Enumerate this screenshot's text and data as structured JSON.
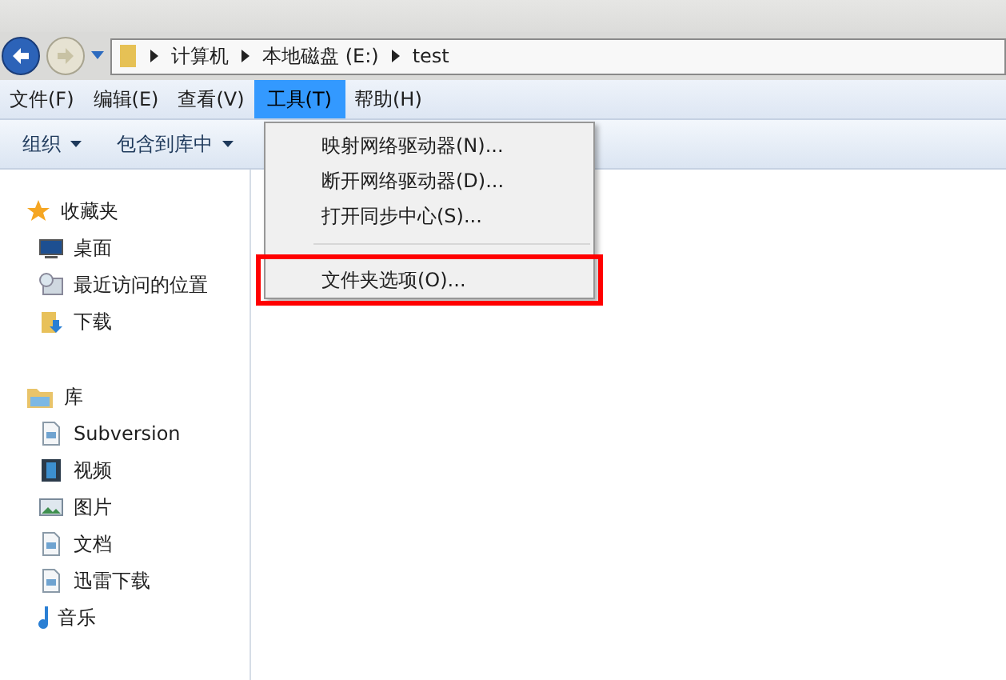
{
  "address_bar": {
    "segments": [
      "计算机",
      "本地磁盘 (E:)",
      "test"
    ]
  },
  "menu_bar": [
    {
      "label": "文件(F)",
      "selected": false
    },
    {
      "label": "编辑(E)",
      "selected": false
    },
    {
      "label": "查看(V)",
      "selected": false
    },
    {
      "label": "工具(T)",
      "selected": true
    },
    {
      "label": "帮助(H)",
      "selected": false
    }
  ],
  "toolbar": [
    "组织",
    "包含到库中"
  ],
  "dropdown_menu": [
    {
      "label": "映射网络驱动器(N)...",
      "kind": "item",
      "annotated": false
    },
    {
      "label": "断开网络驱动器(D)...",
      "kind": "item",
      "annotated": false
    },
    {
      "label": "打开同步中心(S)...",
      "kind": "item",
      "annotated": false
    },
    {
      "kind": "separator"
    },
    {
      "label": "文件夹选项(O)...",
      "kind": "item",
      "annotated": true
    }
  ],
  "sidebar": [
    {
      "label": "收藏夹",
      "kind": "star",
      "children": [
        {
          "label": "桌面",
          "kind": "desktop"
        },
        {
          "label": "最近访问的位置",
          "kind": "recent"
        },
        {
          "label": "下载",
          "kind": "download"
        }
      ]
    },
    {
      "label": "库",
      "kind": "library",
      "children": [
        {
          "label": "Subversion",
          "kind": "doc"
        },
        {
          "label": "视频",
          "kind": "video"
        },
        {
          "label": "图片",
          "kind": "picture"
        },
        {
          "label": "文档",
          "kind": "doc"
        },
        {
          "label": "迅雷下载",
          "kind": "doc"
        },
        {
          "label": "音乐",
          "kind": "music"
        }
      ]
    }
  ]
}
